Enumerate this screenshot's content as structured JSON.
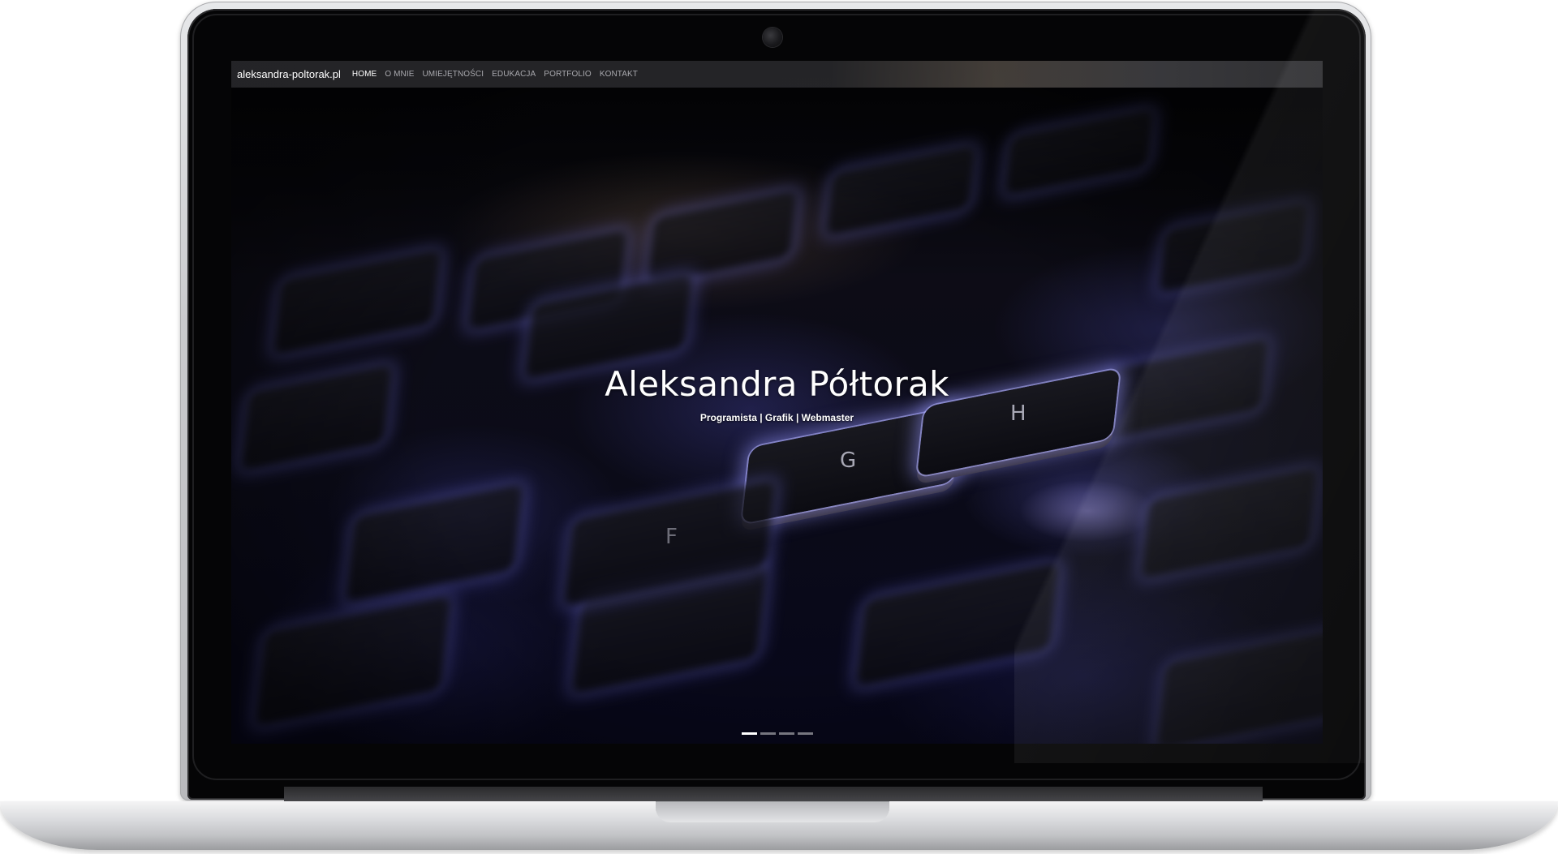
{
  "nav": {
    "brand": "aleksandra-poltorak.pl",
    "items": [
      {
        "label": "HOME",
        "active": true
      },
      {
        "label": "O MNIE",
        "active": false
      },
      {
        "label": "UMIEJĘTNOŚCI",
        "active": false
      },
      {
        "label": "EDUKACJA",
        "active": false
      },
      {
        "label": "PORTFOLIO",
        "active": false
      },
      {
        "label": "KONTAKT",
        "active": false
      }
    ]
  },
  "hero": {
    "title": "Aleksandra Półtorak",
    "subtitle": "Programista | Grafik | Webmaster",
    "key_letters": [
      "G",
      "H",
      "F"
    ]
  },
  "carousel": {
    "slide_count": 4,
    "active_index": 0
  },
  "colors": {
    "nav_text": "#a8a8ad",
    "nav_active": "#ffffff",
    "key_glow": "#6e6ee6"
  }
}
